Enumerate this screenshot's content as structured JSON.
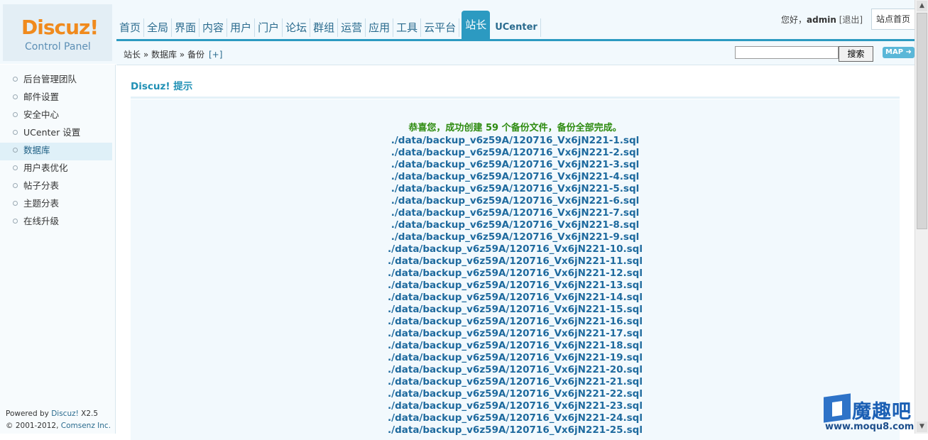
{
  "logo": {
    "brand": "Discuz!",
    "subtitle": "Control Panel"
  },
  "nav": {
    "items": [
      "首页",
      "全局",
      "界面",
      "内容",
      "用户",
      "门户",
      "论坛",
      "群组",
      "运营",
      "应用",
      "工具",
      "云平台"
    ],
    "active": "站长",
    "ucenter": "UCenter"
  },
  "user": {
    "greeting": "您好，",
    "name": "admin",
    "logout": "[退出]",
    "site_home": "站点首页"
  },
  "breadcrumb": {
    "text": "站长 » 数据库 » 备份",
    "plus": "[+]"
  },
  "search": {
    "placeholder": "",
    "button": "搜索",
    "map": "MAP ➜"
  },
  "sidebar": {
    "items": [
      "后台管理团队",
      "邮件设置",
      "安全中心",
      "UCenter 设置",
      "数据库",
      "用户表优化",
      "帖子分表",
      "主题分表",
      "在线升级"
    ],
    "active_index": 4,
    "footer": {
      "powered_prefix": "Powered by ",
      "powered_link": "Discuz!",
      "version": " X2.5",
      "copyright_prefix": "© 2001-2012, ",
      "company": "Comsenz Inc."
    }
  },
  "notice": {
    "title": "Discuz! 提示",
    "message": "恭喜您，成功创建 59 个备份文件，备份全部完成。",
    "files": [
      "./data/backup_v6z59A/120716_Vx6jN221-1.sql",
      "./data/backup_v6z59A/120716_Vx6jN221-2.sql",
      "./data/backup_v6z59A/120716_Vx6jN221-3.sql",
      "./data/backup_v6z59A/120716_Vx6jN221-4.sql",
      "./data/backup_v6z59A/120716_Vx6jN221-5.sql",
      "./data/backup_v6z59A/120716_Vx6jN221-6.sql",
      "./data/backup_v6z59A/120716_Vx6jN221-7.sql",
      "./data/backup_v6z59A/120716_Vx6jN221-8.sql",
      "./data/backup_v6z59A/120716_Vx6jN221-9.sql",
      "./data/backup_v6z59A/120716_Vx6jN221-10.sql",
      "./data/backup_v6z59A/120716_Vx6jN221-11.sql",
      "./data/backup_v6z59A/120716_Vx6jN221-12.sql",
      "./data/backup_v6z59A/120716_Vx6jN221-13.sql",
      "./data/backup_v6z59A/120716_Vx6jN221-14.sql",
      "./data/backup_v6z59A/120716_Vx6jN221-15.sql",
      "./data/backup_v6z59A/120716_Vx6jN221-16.sql",
      "./data/backup_v6z59A/120716_Vx6jN221-17.sql",
      "./data/backup_v6z59A/120716_Vx6jN221-18.sql",
      "./data/backup_v6z59A/120716_Vx6jN221-19.sql",
      "./data/backup_v6z59A/120716_Vx6jN221-20.sql",
      "./data/backup_v6z59A/120716_Vx6jN221-21.sql",
      "./data/backup_v6z59A/120716_Vx6jN221-22.sql",
      "./data/backup_v6z59A/120716_Vx6jN221-23.sql",
      "./data/backup_v6z59A/120716_Vx6jN221-24.sql",
      "./data/backup_v6z59A/120716_Vx6jN221-25.sql"
    ]
  },
  "watermark": {
    "text": "魔趣吧",
    "url": "www.moqu8.com"
  },
  "colors": {
    "accent": "#2c9ac1",
    "success": "#2d8b0f",
    "link": "#1e6a9e",
    "logo": "#f08a1d"
  }
}
